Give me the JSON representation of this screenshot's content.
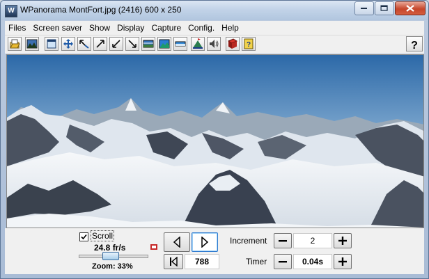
{
  "window": {
    "title": "WPanorama  MontFort.jpg  (2416) 600 x 250",
    "app_icon_glyph": "W"
  },
  "menu": [
    "Files",
    "Screen saver",
    "Show",
    "Display",
    "Capture",
    "Config.",
    "Help"
  ],
  "toolbar": {
    "icons": [
      "open-file",
      "landscape-picture",
      "window",
      "move-arrows",
      "shrink-arrow",
      "arrow-up-right",
      "arrow-down-left",
      "arrow-down-right",
      "wide-picture",
      "panorama",
      "flat-panorama",
      "mountain-flag",
      "speaker",
      "book",
      "help-book"
    ],
    "help_label": "?"
  },
  "controls": {
    "scroll_label": "Scroll",
    "scroll_checked": true,
    "speed": "24.8 fr/s",
    "zoom": "Zoom: 33%",
    "zoom_value_percent": 33,
    "position": "788",
    "increment_label": "Increment",
    "increment_value": "2",
    "timer_label": "Timer",
    "timer_value": "0.04s",
    "minus_glyph": "−",
    "plus_glyph": "+"
  },
  "colors": {
    "sky_top": "#2e6aa8",
    "sky_bottom": "#c3d8ea",
    "snow": "#f4f6f8",
    "rock": "#3b4350",
    "accent": "#2f7bd0"
  }
}
